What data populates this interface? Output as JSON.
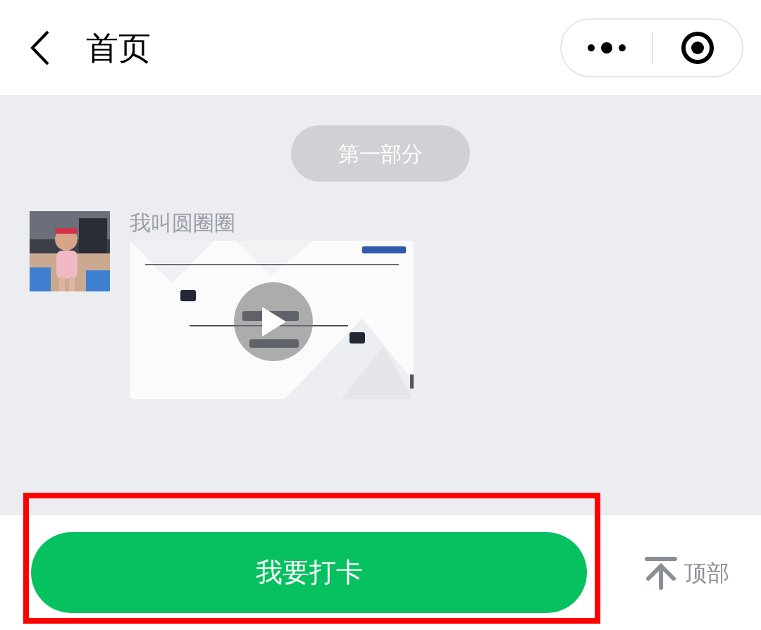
{
  "header": {
    "title": "首页"
  },
  "section": {
    "label": "第一部分"
  },
  "messages": [
    {
      "sender": "我叫圆圈圈",
      "attachment": {
        "kind": "video"
      }
    }
  ],
  "bottom_bar": {
    "primary_button": "我要打卡",
    "top_link": "顶部"
  }
}
